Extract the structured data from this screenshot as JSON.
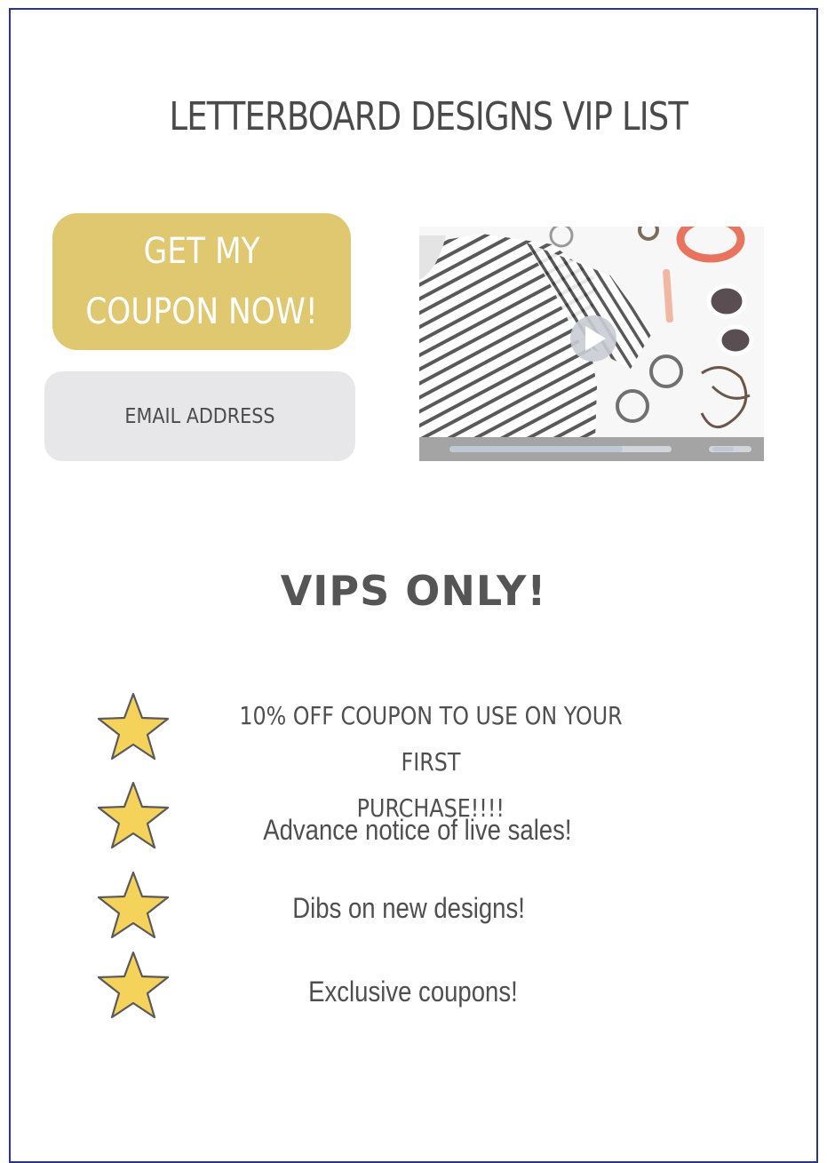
{
  "title": "LETTERBOARD DESIGNS VIP LIST",
  "signup": {
    "button_line1": "GET MY",
    "button_line2": "COUPON NOW!",
    "email_placeholder": "EMAIL ADDRESS"
  },
  "video": {
    "play_icon": "play-icon",
    "progress": 0.78
  },
  "section_title": "VIPS ONLY!",
  "perks": [
    {
      "line1": "10% OFF COUPON TO USE ON YOUR FIRST",
      "line2": "PURCHASE!!!!"
    },
    {
      "text": "Advance notice of live sales!"
    },
    {
      "text": "Dibs on new designs!"
    },
    {
      "text": "Exclusive coupons!"
    }
  ],
  "colors": {
    "frame": "#2b3486",
    "button": "#dfc870",
    "email_bg": "#e7e7e9",
    "star_fill": "#f5d35a",
    "text": "#4f4f4f"
  }
}
